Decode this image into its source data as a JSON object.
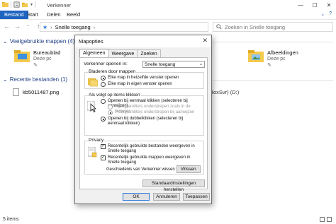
{
  "explorer": {
    "title": "Verkenner",
    "ribbon_tabs": [
      "Bestand",
      "Start",
      "Delen",
      "Beeld"
    ],
    "address_path": "Snelle toegang",
    "search_placeholder": "Zoeken in Snelle toegang",
    "frequent_header": "Veelgebruikte mappen (4)",
    "frequent_items": [
      {
        "name": "Bureaublad",
        "sub": "Deze pc"
      },
      {
        "name": "Afbeeldingen",
        "sub": "Deze pc"
      }
    ],
    "recent_header": "Recente bestanden (1)",
    "recent_file": "kb5011487.png",
    "recent_bg_text": "BoxSvr) (D:)",
    "status_count": "5 items"
  },
  "dialog": {
    "title": "Mapopties",
    "tabs": [
      "Algemeen",
      "Weergave",
      "Zoeken"
    ],
    "open_label": "Verkenner openen in:",
    "open_value": "Snelle toegang",
    "browse_title": "Bladeren door mappen",
    "browse_options": [
      "Elke map in hetzelfde venster openen",
      "Elke map in eigen venster openen"
    ],
    "click_title": "Als volgt op items klikken",
    "click_single": "Openen bij eenmaal klikken (selecteren bij aanwijzen)",
    "click_sub1": "Pictogramtitels onderstrepen zoals in de browser",
    "click_sub2": "Pictogramtitels onderstrepen bij aanwijzen",
    "click_double": "Openen bij dubbelklikken (selecteren bij eenmaal klikken)",
    "privacy_title": "Privacy",
    "privacy_check1": "Recentelijk gebruikte bestanden weergeven in Snelle toegang",
    "privacy_check2": "Recentelijk gebruikte mappen weergeven in Snelle toegang",
    "clear_label": "Geschiedenis van Verkenner wissen",
    "clear_button": "Wissen",
    "restore_button": "Standaardinstellingen herstellen",
    "ok_button": "OK",
    "cancel_button": "Annuleren",
    "apply_button": "Toepassen"
  },
  "colors": {
    "accent": "#1f64c0",
    "folder": "#f4c94c",
    "header_text": "#1f3f86"
  }
}
